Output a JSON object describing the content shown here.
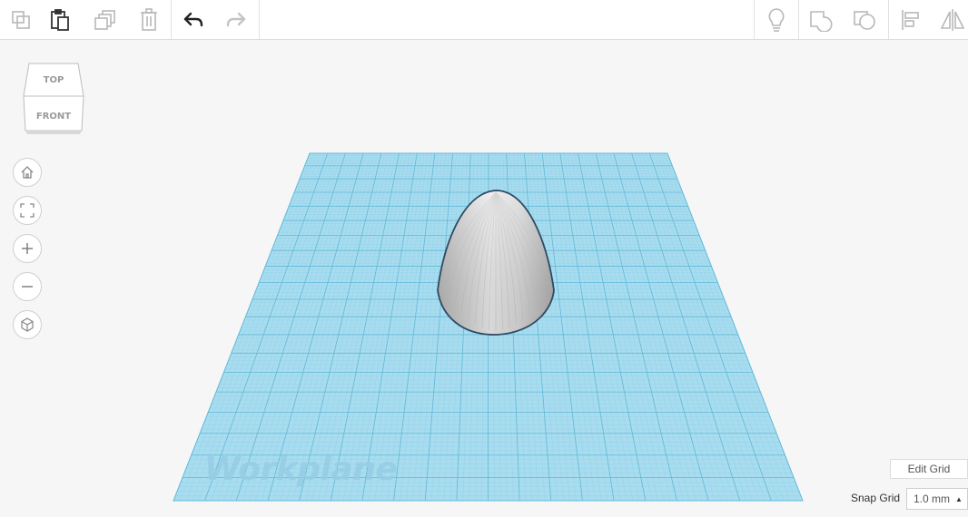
{
  "toolbar": {
    "left": [
      {
        "name": "copy-button",
        "icon": "copy-icon",
        "enabled": false
      },
      {
        "name": "paste-button",
        "icon": "paste-icon",
        "enabled": true
      },
      {
        "name": "duplicate-button",
        "icon": "duplicate-icon",
        "enabled": false
      },
      {
        "name": "delete-button",
        "icon": "trash-icon",
        "enabled": false
      },
      {
        "name": "undo-button",
        "icon": "undo-icon",
        "enabled": true
      },
      {
        "name": "redo-button",
        "icon": "redo-icon",
        "enabled": false
      }
    ],
    "right": [
      {
        "name": "show-hide-button",
        "icon": "lightbulb-icon"
      },
      {
        "name": "group-button",
        "icon": "group-icon"
      },
      {
        "name": "ungroup-button",
        "icon": "ungroup-icon"
      },
      {
        "name": "align-button",
        "icon": "align-icon"
      },
      {
        "name": "mirror-button",
        "icon": "mirror-icon"
      }
    ]
  },
  "viewcube": {
    "top_label": "TOP",
    "front_label": "FRONT"
  },
  "nav_controls": [
    {
      "name": "home-view-button",
      "icon": "home-icon"
    },
    {
      "name": "fit-view-button",
      "icon": "fit-icon"
    },
    {
      "name": "zoom-in-button",
      "icon": "plus-icon"
    },
    {
      "name": "zoom-out-button",
      "icon": "minus-icon"
    },
    {
      "name": "ortho-view-button",
      "icon": "cube-icon"
    }
  ],
  "workplane": {
    "label": "Workplane"
  },
  "grid": {
    "edit_label": "Edit Grid",
    "snap_label": "Snap Grid",
    "snap_value": "1.0 mm"
  },
  "colors": {
    "grid_fill": "#a9dcef",
    "grid_line": "#6cc0dd",
    "shape_fill": "#c9c9c9",
    "shape_outline": "#2f4a63",
    "toolbar_bg": "#ffffff",
    "canvas_bg": "#f6f6f6"
  }
}
